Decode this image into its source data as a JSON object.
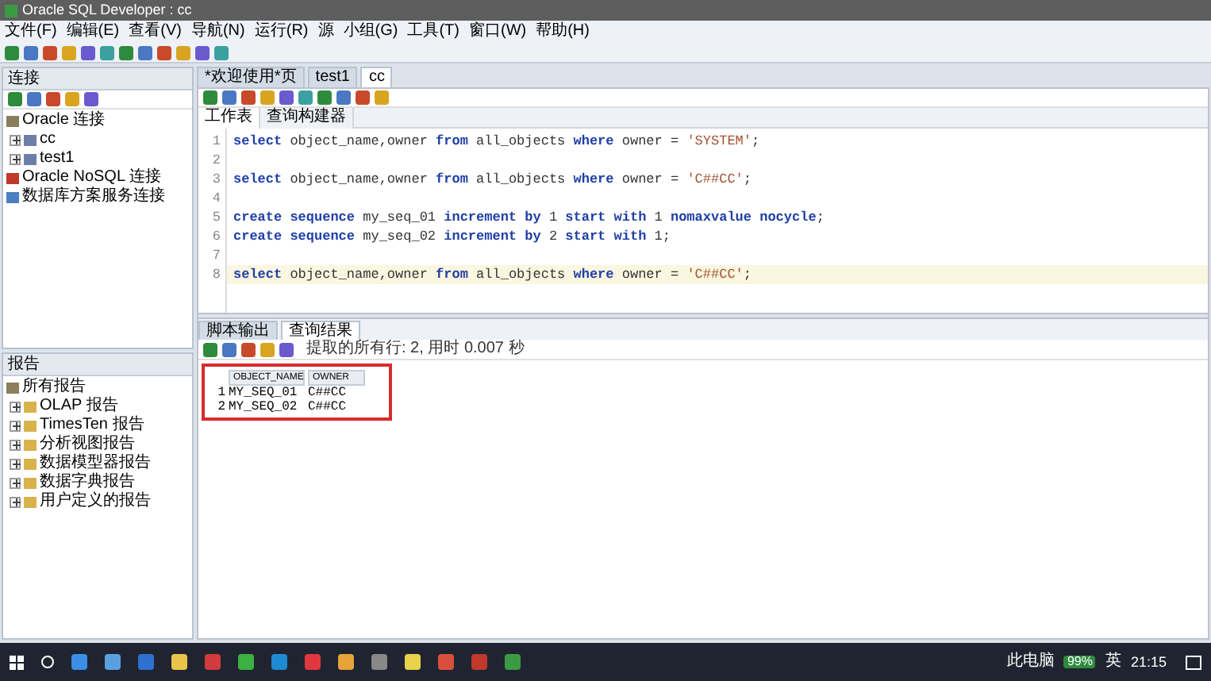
{
  "window": {
    "title": "Oracle SQL Developer : cc"
  },
  "menu": [
    "文件(F)",
    "编辑(E)",
    "查看(V)",
    "导航(N)",
    "运行(R)",
    "源",
    "小组(G)",
    "工具(T)",
    "窗口(W)",
    "帮助(H)"
  ],
  "connections_panel": {
    "title": "连接",
    "tree": [
      {
        "label": "Oracle 连接",
        "kind": "root",
        "children": [
          {
            "label": "cc",
            "kind": "db",
            "expanded": false
          },
          {
            "label": "test1",
            "kind": "db",
            "expanded": false
          }
        ]
      },
      {
        "label": "Oracle NoSQL 连接",
        "kind": "nosql"
      },
      {
        "label": "数据库方案服务连接",
        "kind": "service"
      }
    ]
  },
  "reports_panel": {
    "title": "报告",
    "tree": [
      {
        "label": "所有报告",
        "kind": "root",
        "children": [
          {
            "label": "OLAP 报告",
            "kind": "folder",
            "expanded": false
          },
          {
            "label": "TimesTen 报告",
            "kind": "folder",
            "expanded": false
          },
          {
            "label": "分析视图报告",
            "kind": "folder",
            "expanded": false
          },
          {
            "label": "数据模型器报告",
            "kind": "folder",
            "expanded": false
          },
          {
            "label": "数据字典报告",
            "kind": "folder",
            "expanded": false
          },
          {
            "label": "用户定义的报告",
            "kind": "folder",
            "expanded": false
          }
        ]
      }
    ]
  },
  "editor_tabs": [
    {
      "label": "*欢迎使用*页",
      "selected": false
    },
    {
      "label": "test1",
      "selected": false
    },
    {
      "label": "cc",
      "selected": true
    }
  ],
  "sub_tabs": [
    {
      "label": "工作表",
      "selected": true
    },
    {
      "label": "查询构建器",
      "selected": false
    }
  ],
  "code_lines": [
    {
      "number": "1",
      "current": false,
      "tokens": [
        {
          "kind": "keyword",
          "text": "select"
        },
        {
          "kind": "plain",
          "text": " object_name,owner "
        },
        {
          "kind": "keyword",
          "text": "from"
        },
        {
          "kind": "plain",
          "text": " all_objects "
        },
        {
          "kind": "keyword",
          "text": "where"
        },
        {
          "kind": "plain",
          "text": " owner = "
        },
        {
          "kind": "string",
          "text": "'SYSTEM'"
        },
        {
          "kind": "plain",
          "text": ";"
        }
      ]
    },
    {
      "number": "2",
      "current": false
    },
    {
      "number": "3",
      "current": false,
      "tokens": [
        {
          "kind": "keyword",
          "text": "select"
        },
        {
          "kind": "plain",
          "text": " object_name,owner "
        },
        {
          "kind": "keyword",
          "text": "from"
        },
        {
          "kind": "plain",
          "text": " all_objects "
        },
        {
          "kind": "keyword",
          "text": "where"
        },
        {
          "kind": "plain",
          "text": " owner = "
        },
        {
          "kind": "string",
          "text": "'C##CC'"
        },
        {
          "kind": "plain",
          "text": ";"
        }
      ]
    },
    {
      "number": "4",
      "current": false
    },
    {
      "number": "5",
      "current": false,
      "tokens": [
        {
          "kind": "keyword",
          "text": "create sequence"
        },
        {
          "kind": "plain",
          "text": " my_seq_01 "
        },
        {
          "kind": "keyword",
          "text": "increment by"
        },
        {
          "kind": "plain",
          "text": " 1 "
        },
        {
          "kind": "keyword",
          "text": "start with"
        },
        {
          "kind": "plain",
          "text": " 1 "
        },
        {
          "kind": "keyword",
          "text": "nomaxvalue nocycle"
        },
        {
          "kind": "plain",
          "text": ";"
        }
      ]
    },
    {
      "number": "6",
      "current": false,
      "tokens": [
        {
          "kind": "keyword",
          "text": "create sequence"
        },
        {
          "kind": "plain",
          "text": " my_seq_02 "
        },
        {
          "kind": "keyword",
          "text": "increment by"
        },
        {
          "kind": "plain",
          "text": " 2 "
        },
        {
          "kind": "keyword",
          "text": "start with"
        },
        {
          "kind": "plain",
          "text": " 1;"
        }
      ]
    },
    {
      "number": "7",
      "current": false
    },
    {
      "number": "8",
      "current": true,
      "tokens": [
        {
          "kind": "keyword",
          "text": "select"
        },
        {
          "kind": "plain",
          "text": " object_name,owner "
        },
        {
          "kind": "keyword",
          "text": "from"
        },
        {
          "kind": "plain",
          "text": " all_objects "
        },
        {
          "kind": "keyword",
          "text": "where"
        },
        {
          "kind": "plain",
          "text": " owner = "
        },
        {
          "kind": "string",
          "text": "'C##CC'"
        },
        {
          "kind": "plain",
          "text": ";"
        }
      ]
    }
  ],
  "output_tabs": [
    {
      "label": "脚本输出",
      "selected": false
    },
    {
      "label": "查询结果",
      "selected": true
    }
  ],
  "status": "提取的所有行: 2, 用时 0.007 秒",
  "results": {
    "columns": [
      "OBJECT_NAME",
      "OWNER"
    ],
    "rows": [
      {
        "number": "1",
        "cells": [
          "MY_SEQ_01",
          "C##CC"
        ]
      },
      {
        "number": "2",
        "cells": [
          "MY_SEQ_02",
          "C##CC"
        ]
      }
    ]
  },
  "taskbar": {
    "tray": {
      "label": "此电脑",
      "battery": "99%",
      "ime": "英",
      "time": "21:15"
    }
  }
}
